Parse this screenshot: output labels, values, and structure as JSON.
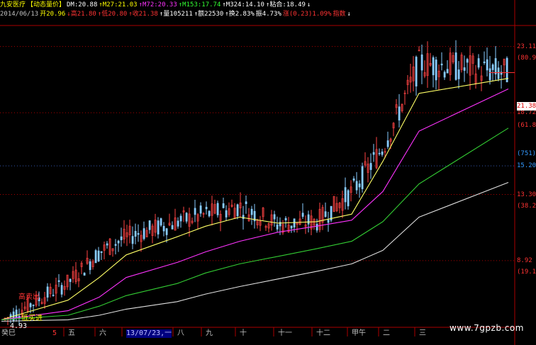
{
  "header": {
    "line1": [
      {
        "text": "九安医疗",
        "color": "#ffff00"
      },
      {
        "text": "【动态量价】",
        "color": "#ffff00"
      },
      {
        "text": "DM:20.88",
        "color": "#ffffff"
      },
      {
        "text": "↑M27:21.03",
        "color": "#ffff00"
      },
      {
        "text": "↑M72:20.33",
        "color": "#ff33ff"
      },
      {
        "text": "↑M153:17.74",
        "color": "#33ff33"
      },
      {
        "text": "↑M324:14.10",
        "color": "#ffffff"
      },
      {
        "text": "↑粘合:18.49",
        "color": "#ffffff"
      },
      {
        "text": "↓",
        "color": "#ffffff"
      }
    ],
    "line2": [
      {
        "text": "2014/06/13",
        "color": "#c0c0c0"
      },
      {
        "text": "开20.96",
        "color": "#ffff00"
      },
      {
        "text": "↓高21.80",
        "color": "#ff3333"
      },
      {
        "text": "↑低20.80",
        "color": "#ff3333"
      },
      {
        "text": "↑收21.38",
        "color": "#ff3333"
      },
      {
        "text": "↑量105211",
        "color": "#ffffff"
      },
      {
        "text": "↑额22530",
        "color": "#ffffff"
      },
      {
        "text": "↑换2.83%",
        "color": "#ffffff"
      },
      {
        "text": "振4.73%",
        "color": "#ffffff"
      },
      {
        "text": "涨(0.23)1.09%",
        "color": "#ff3333"
      },
      {
        "text": "指数",
        "color": "#ff3333"
      },
      {
        "text": "↓",
        "color": "#ffffff"
      }
    ]
  },
  "price_tag": "21.38",
  "y_labels": [
    {
      "text": "23.11",
      "color": "#ff3333",
      "value": 23.11
    },
    {
      "text": "(80.9%)",
      "color": "#ff3333",
      "value": 22.35
    },
    {
      "text": "18.72",
      "color": "#ff3333",
      "value": 18.72
    },
    {
      "text": "(61.8%)",
      "color": "#ff3333",
      "value": 17.9
    },
    {
      "text": "(751)",
      "color": "#3399ff",
      "value": 16.0
    },
    {
      "text": "15.20",
      "color": "#3399ff",
      "value": 15.2
    },
    {
      "text": "13.30",
      "color": "#ff3333",
      "value": 13.3
    },
    {
      "text": "(38.2%)",
      "color": "#ff3333",
      "value": 12.55
    },
    {
      "text": "8.92",
      "color": "#ff3333",
      "value": 8.92
    },
    {
      "text": "(19.1%)",
      "color": "#ff3333",
      "value": 8.15
    }
  ],
  "x_labels": [
    "癸巳",
    "5",
    "五",
    "六",
    "13/07/23,一",
    "八",
    "九",
    "十",
    "十一",
    "十二",
    "甲午",
    "二",
    "三"
  ],
  "signals": {
    "sell": "高卖出",
    "buy": "低买进",
    "low_price": "4.93"
  },
  "watermark": "www.7gpzb.com",
  "colors": {
    "ma27": "#ffff66",
    "ma72": "#ff33ff",
    "ma153": "#33cc33",
    "ma324": "#e0e0e0",
    "candle": "#88ccff",
    "grid": "#aa0000",
    "price_line": "#ff3333"
  },
  "chart_data": {
    "type": "line",
    "x_categories": [
      "癸巳",
      "5",
      "五",
      "六",
      "13/07/23,一",
      "八",
      "九",
      "十",
      "十一",
      "十二",
      "甲午",
      "二",
      "三"
    ],
    "ylim": [
      4.5,
      24.5
    ],
    "series": [
      {
        "name": "M27",
        "values": [
          5.0,
          6.3,
          7.8,
          9.3,
          10.5,
          11.2,
          11.8,
          11.4,
          11.5,
          12.0,
          15.5,
          20.0,
          21.0
        ]
      },
      {
        "name": "M72",
        "values": [
          5.0,
          5.6,
          6.5,
          7.8,
          8.8,
          9.5,
          10.2,
          10.8,
          11.2,
          11.6,
          13.5,
          17.5,
          20.3
        ]
      },
      {
        "name": "M153",
        "values": [
          5.0,
          5.3,
          5.9,
          6.6,
          7.4,
          8.1,
          8.7,
          9.2,
          9.7,
          10.2,
          11.5,
          14.0,
          17.7
        ]
      },
      {
        "name": "M324",
        "values": [
          4.9,
          5.0,
          5.3,
          5.7,
          6.2,
          6.7,
          7.2,
          7.7,
          8.2,
          8.7,
          9.6,
          11.8,
          14.1
        ]
      }
    ],
    "price": [
      4.93,
      7.5,
      9.5,
      10.5,
      11.5,
      12.0,
      12.5,
      11.3,
      11.5,
      13.5,
      16.5,
      22.0,
      21.38
    ]
  }
}
